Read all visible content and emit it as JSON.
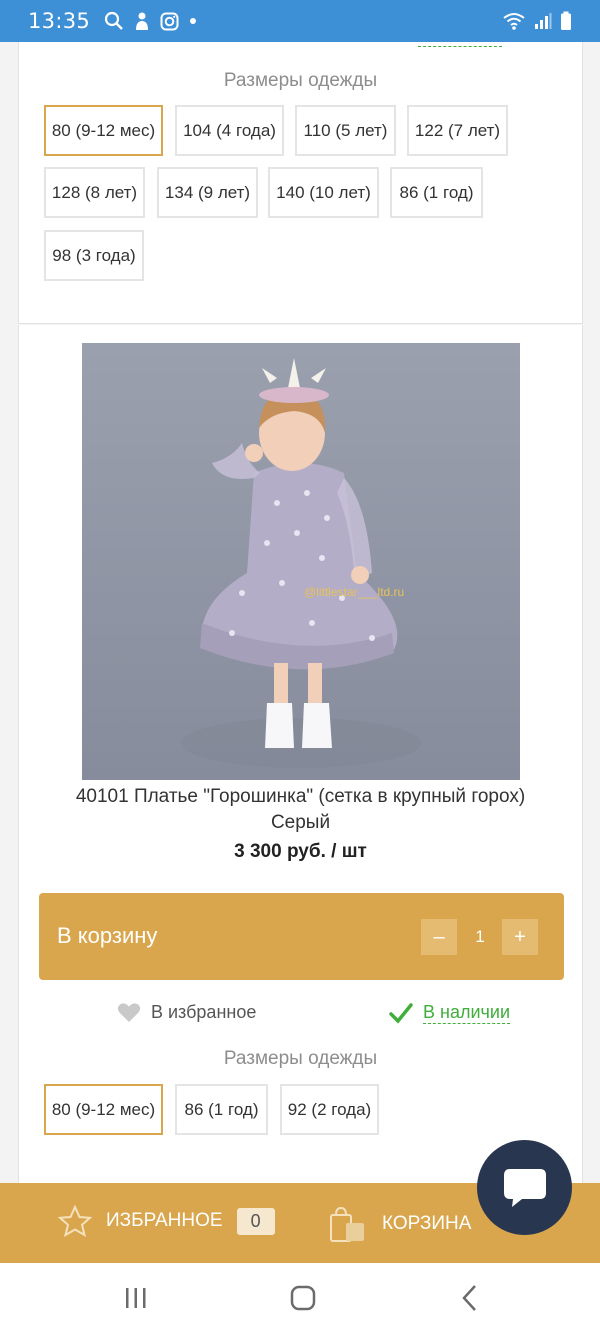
{
  "status_bar": {
    "time": "13:35",
    "icons": [
      "search-icon",
      "hand-icon",
      "instagram-icon",
      "dot-icon"
    ],
    "right_icons": [
      "wifi-icon",
      "signal-icon",
      "battery-icon"
    ]
  },
  "top_card": {
    "sizes_title": "Размеры одежды",
    "sizes": [
      "80 (9-12 мес)",
      "104 (4 года)",
      "110 (5 лет)",
      "122 (7 лет)",
      "128 (8 лет)",
      "134 (9 лет)",
      "140 (10 лет)",
      "86 (1 год)",
      "98 (3 года)"
    ],
    "selected_size": "80 (9-12 мес)"
  },
  "product": {
    "image_caption": "@littlestar___ltd.ru",
    "name_line1": "40101 Платье \"Горошинка\" (сетка в крупный горох)",
    "name_line2": "Серый",
    "price": "3 300 руб. / шт",
    "add_to_cart": "В корзину",
    "qty_minus": "–",
    "qty_value": "1",
    "qty_plus": "+",
    "favorite": "В избранное",
    "in_stock": "В наличии",
    "sizes_title": "Размеры одежды",
    "sizes": [
      "80 (9-12 мес)",
      "86 (1 год)",
      "92 (2 года)"
    ],
    "selected_size": "80 (9-12 мес)"
  },
  "bottom_bar": {
    "favorites_label": "ИЗБРАННОЕ",
    "favorites_count": "0",
    "cart_label": "КОРЗИНА"
  },
  "colors": {
    "accent": "#d9a64d",
    "status_bar": "#3d8fd6",
    "in_stock": "#3fae3a",
    "chat": "#283650"
  }
}
